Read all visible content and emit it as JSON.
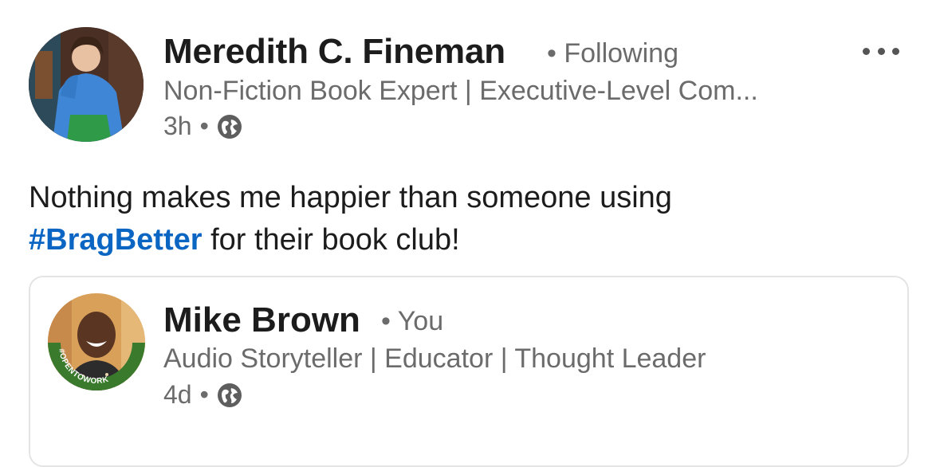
{
  "post": {
    "author": {
      "name": "Meredith C. Fineman",
      "relation_separator": "•",
      "relation": "Following",
      "headline": "Non-Fiction Book Expert | Executive-Level Com...",
      "time": "3h",
      "time_separator": "•",
      "visibility_icon": "globe-icon"
    },
    "more_icon": "more-options-icon",
    "body": {
      "text_before": "Nothing makes me happier than someone using",
      "hashtag": "#BragBetter",
      "text_after": " for their book club!"
    }
  },
  "shared_post": {
    "author": {
      "name": "Mike Brown",
      "relation_separator": "•",
      "relation": "You",
      "headline": "Audio Storyteller | Educator | Thought Leader",
      "time": "4d",
      "time_separator": "•",
      "visibility_icon": "globe-icon",
      "badge_text": "#OPENTOWORK"
    }
  },
  "colors": {
    "hashtag": "#0a66c2",
    "open_to_work_ring": "#3a7a2c",
    "meta_text": "#6b6b6b"
  }
}
